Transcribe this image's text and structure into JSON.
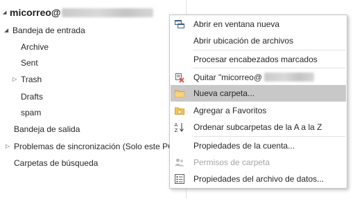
{
  "account": {
    "name_prefix": "micorreo@"
  },
  "tree": {
    "items": [
      {
        "label": "Bandeja de entrada",
        "caret": "◢"
      },
      {
        "label": "Archive"
      },
      {
        "label": "Sent"
      },
      {
        "label": "Trash",
        "caret": "▷"
      },
      {
        "label": "Drafts"
      },
      {
        "label": "spam"
      },
      {
        "label": "Bandeja de salida"
      },
      {
        "label": "Problemas de sincronización (Solo este PC)",
        "caret": "▷"
      },
      {
        "label": "Carpetas de búsqueda"
      }
    ]
  },
  "context_menu": {
    "items": [
      {
        "label": "Abrir en ventana nueva",
        "icon": "new-window-icon"
      },
      {
        "label": "Abrir ubicación de archivos"
      },
      {
        "label": "Procesar encabezados marcados"
      },
      {
        "label": "Quitar \"micorreo@",
        "icon": "remove-account-icon"
      },
      {
        "label": "Nueva carpeta...",
        "icon": "folder-icon",
        "highlighted": true
      },
      {
        "label": "Agregar a Favoritos",
        "icon": "favorite-folder-icon"
      },
      {
        "label": "Ordenar subcarpetas de la A a la Z",
        "icon": "sort-az-icon"
      },
      {
        "label": "Propiedades de la cuenta..."
      },
      {
        "label": "Permisos de carpeta",
        "icon": "permissions-icon",
        "disabled": true
      },
      {
        "label": "Propiedades del archivo de datos...",
        "icon": "properties-icon"
      }
    ]
  },
  "colors": {
    "highlight": "#c8c8c8",
    "disabled_text": "#a6a6a6",
    "separator": "#e2e2e2",
    "folder_yellow": "#f2c45a",
    "remove_red": "#d9534f"
  }
}
